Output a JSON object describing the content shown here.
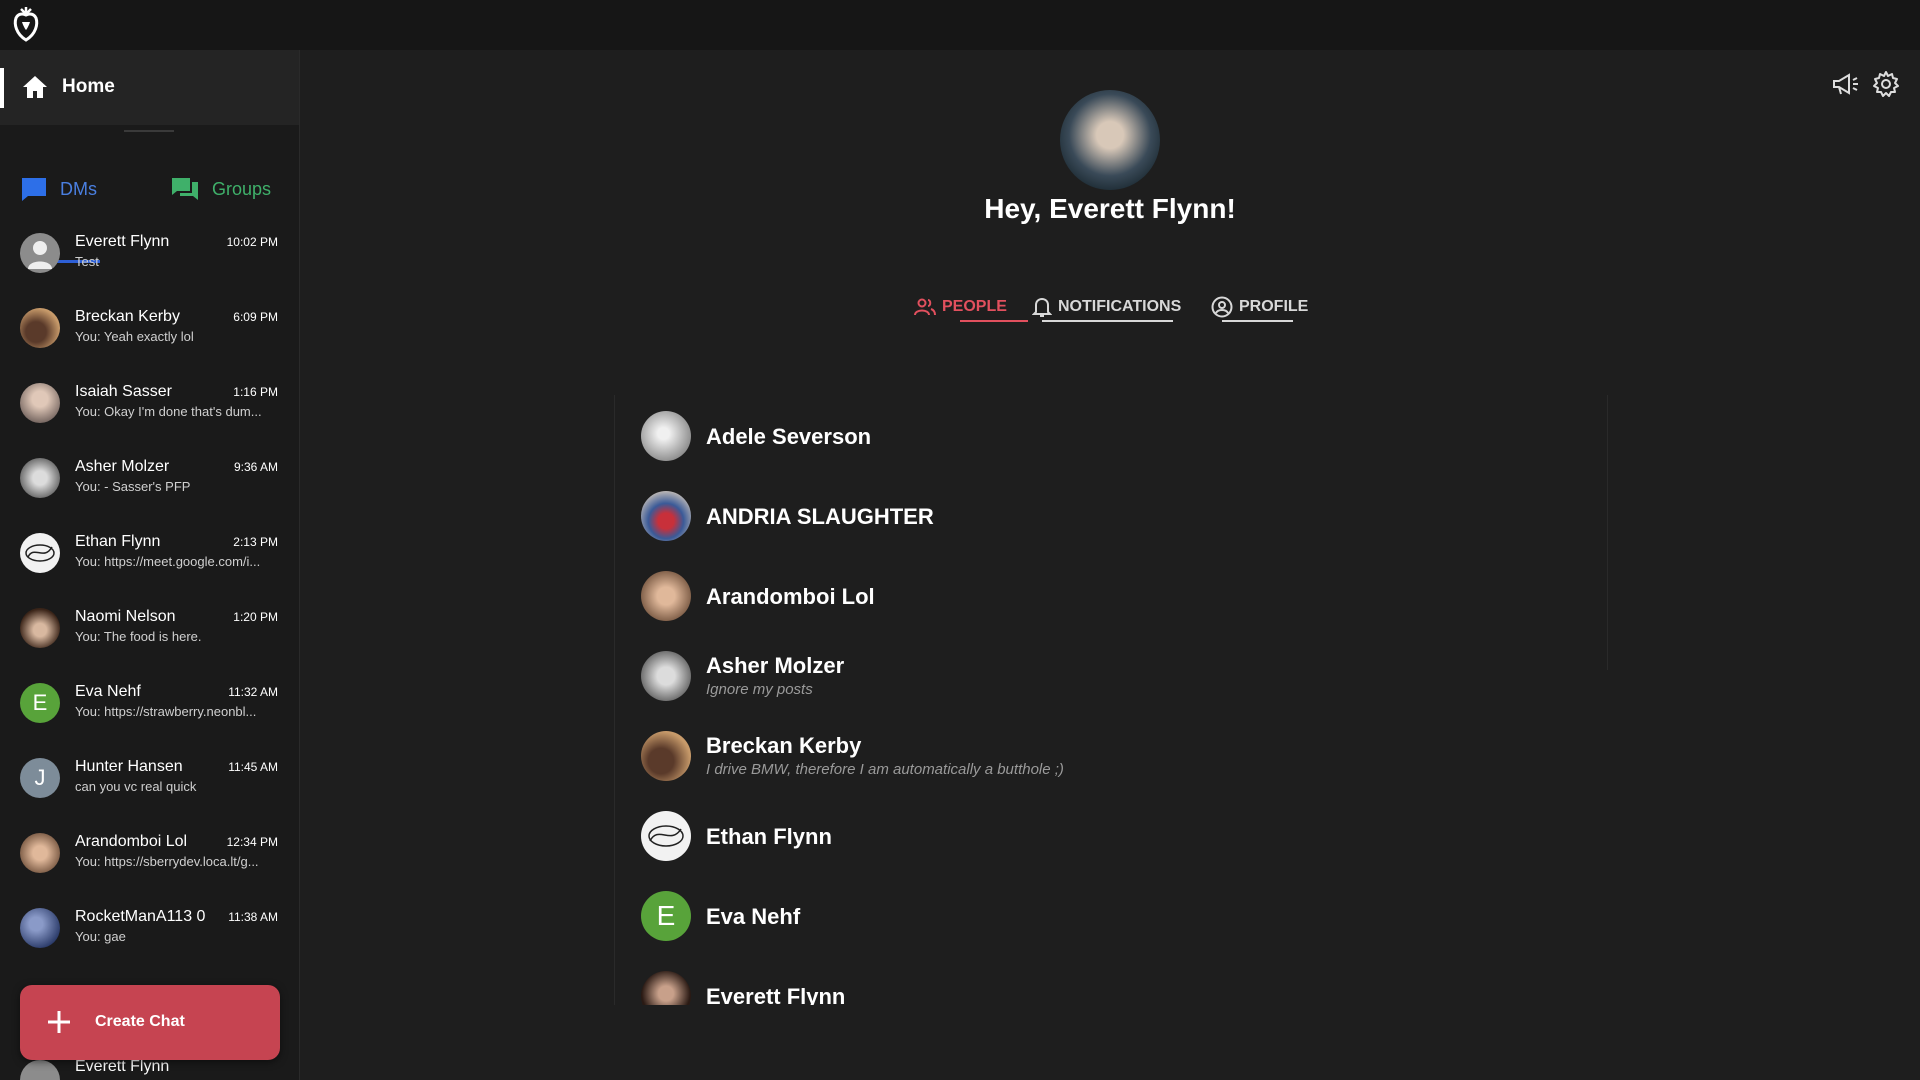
{
  "sidebar": {
    "home_label": "Home",
    "tabs": {
      "dms": "DMs",
      "groups": "Groups"
    },
    "chats": [
      {
        "name": "Everett Flynn",
        "time": "10:02 PM",
        "preview": "Test",
        "avatar_color": "#8c8c8c"
      },
      {
        "name": "Breckan Kerby",
        "time": "6:09 PM",
        "preview": "You: Yeah exactly lol",
        "avatar_color": "#a77a54"
      },
      {
        "name": "Isaiah Sasser",
        "time": "1:16 PM",
        "preview": "You: Okay I'm done that's dum...",
        "avatar_color": "#b8a6a0"
      },
      {
        "name": "Asher Molzer",
        "time": "9:36 AM",
        "preview": "You: - Sasser's PFP",
        "avatar_color": "#9c9c9c"
      },
      {
        "name": "Ethan Flynn",
        "time": "2:13 PM",
        "preview": "You: https://meet.google.com/i...",
        "avatar_color": "#f2f2f2"
      },
      {
        "name": "Naomi Nelson",
        "time": "1:20 PM",
        "preview": "You: The food is here.",
        "avatar_color": "#6a4a38"
      },
      {
        "name": "Eva Nehf",
        "time": "11:32 AM",
        "preview": "You: https://strawberry.neonbl...",
        "avatar_color": "#58a33a",
        "initial": "E"
      },
      {
        "name": "Hunter Hansen",
        "time": "11:45 AM",
        "preview": "can you vc real quick",
        "avatar_color": "#7d8c99",
        "initial": "J"
      },
      {
        "name": "Arandomboi Lol",
        "time": "12:34 PM",
        "preview": "You: https://sberrydev.loca.lt/g...",
        "avatar_color": "#a8826a"
      },
      {
        "name": "RocketManA113 0",
        "time": "11:38 AM",
        "preview": "You: gae",
        "avatar_color": "#4a5f88"
      }
    ],
    "create_chat_label": "Create Chat",
    "bottom_item_name": "Everett Flynn"
  },
  "main": {
    "greeting": "Hey, Everett Flynn!",
    "tabs": {
      "people": "PEOPLE",
      "notifications": "NOTIFICATIONS",
      "profile": "PROFILE"
    },
    "people": [
      {
        "name": "Adele Severson",
        "bio": "",
        "avatar_color": "#b8b8b8"
      },
      {
        "name": "ANDRIA SLAUGHTER",
        "bio": "",
        "avatar_color": "#5a6a88"
      },
      {
        "name": "Arandomboi Lol",
        "bio": "",
        "avatar_color": "#a8826a"
      },
      {
        "name": "Asher Molzer",
        "bio": "Ignore my posts",
        "avatar_color": "#9c9c9c"
      },
      {
        "name": "Breckan Kerby",
        "bio": "I drive BMW, therefore I am automatically a butthole ;)",
        "avatar_color": "#a77a54"
      },
      {
        "name": "Ethan Flynn",
        "bio": "",
        "avatar_color": "#f2f2f2"
      },
      {
        "name": "Eva Nehf",
        "bio": "",
        "avatar_color": "#58a33a",
        "initial": "E"
      },
      {
        "name": "Everett Flynn",
        "bio": "",
        "avatar_color": "#3a2a22"
      }
    ]
  },
  "colors": {
    "accent_red": "#c64451",
    "tab_active_red": "#e2505e",
    "dms_blue": "#4a7fe0",
    "groups_green": "#3fb06a",
    "background": "#1e1e1e",
    "sidebar": "#1a1a1a"
  },
  "icons": [
    "strawberry-logo-icon",
    "home-icon",
    "dms-chat-icon",
    "groups-chat-icon",
    "plus-icon",
    "megaphone-icon",
    "gear-icon",
    "people-icon",
    "bell-icon",
    "profile-circle-icon"
  ]
}
